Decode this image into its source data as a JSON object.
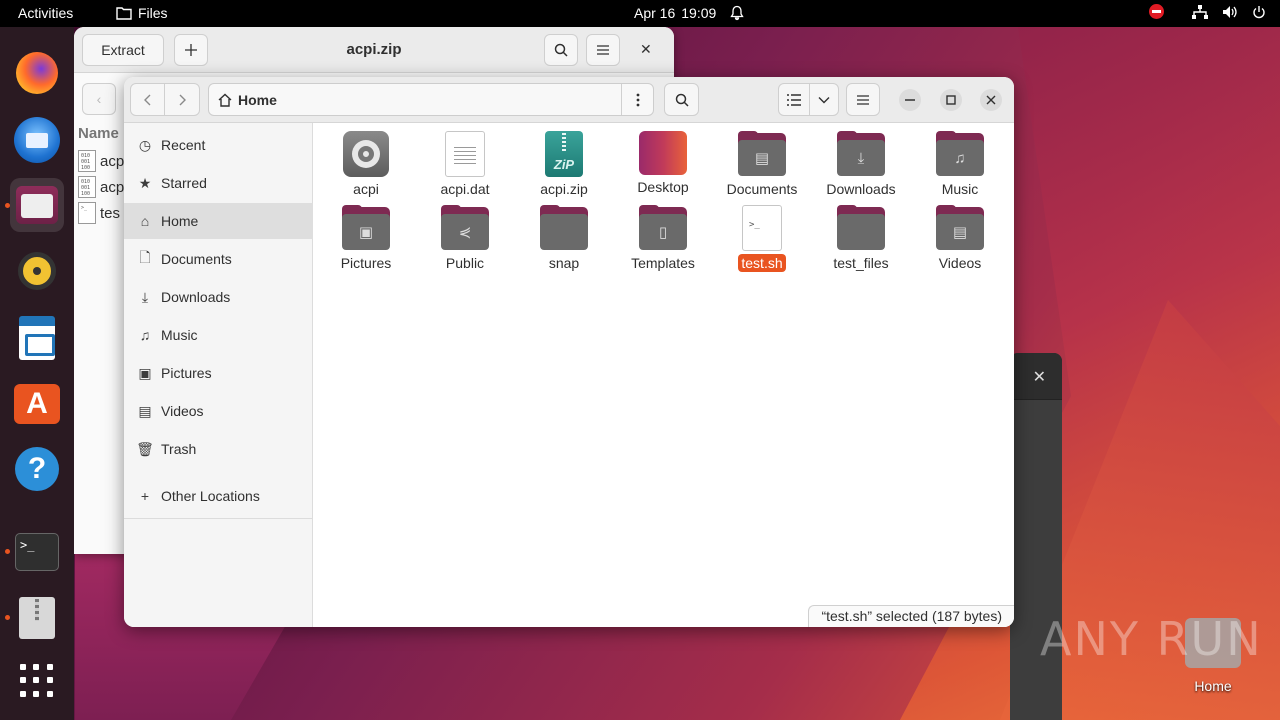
{
  "topbar": {
    "activities": "Activities",
    "app_name": "Files",
    "date": "Apr 16",
    "time": "19:09"
  },
  "dock": {
    "items": [
      "firefox",
      "thunderbird",
      "files",
      "rhythmbox",
      "libreoffice-writer",
      "app-center",
      "help",
      "terminal",
      "archive-manager",
      "show-apps"
    ]
  },
  "archive_window": {
    "extract_label": "Extract",
    "title": "acpi.zip",
    "name_header": "Name",
    "rows": [
      "acpi",
      "acpi",
      "tes"
    ]
  },
  "files_window": {
    "path": "Home",
    "sidebar": [
      {
        "label": "Recent",
        "icon": "clock-icon"
      },
      {
        "label": "Starred",
        "icon": "star-icon"
      },
      {
        "label": "Home",
        "icon": "home-icon"
      },
      {
        "label": "Documents",
        "icon": "document-icon"
      },
      {
        "label": "Downloads",
        "icon": "download-icon"
      },
      {
        "label": "Music",
        "icon": "music-icon"
      },
      {
        "label": "Pictures",
        "icon": "picture-icon"
      },
      {
        "label": "Videos",
        "icon": "video-icon"
      },
      {
        "label": "Trash",
        "icon": "trash-icon"
      }
    ],
    "other_locations": "Other Locations",
    "items": [
      {
        "label": "acpi",
        "kind": "executable"
      },
      {
        "label": "acpi.dat",
        "kind": "text"
      },
      {
        "label": "acpi.zip",
        "kind": "zip"
      },
      {
        "label": "Desktop",
        "kind": "desktop-folder"
      },
      {
        "label": "Documents",
        "kind": "folder"
      },
      {
        "label": "Downloads",
        "kind": "folder"
      },
      {
        "label": "Music",
        "kind": "folder"
      },
      {
        "label": "Pictures",
        "kind": "folder"
      },
      {
        "label": "Public",
        "kind": "folder"
      },
      {
        "label": "snap",
        "kind": "folder"
      },
      {
        "label": "Templates",
        "kind": "folder"
      },
      {
        "label": "test.sh",
        "kind": "script",
        "selected": true
      },
      {
        "label": "test_files",
        "kind": "folder"
      },
      {
        "label": "Videos",
        "kind": "folder"
      }
    ],
    "status": "“test.sh” selected  (187 bytes)"
  },
  "desktop": {
    "home_label": "Home",
    "watermark": "ANY RUN"
  },
  "colors": {
    "accent": "#e95420",
    "folder_tab": "#7e2a52"
  }
}
